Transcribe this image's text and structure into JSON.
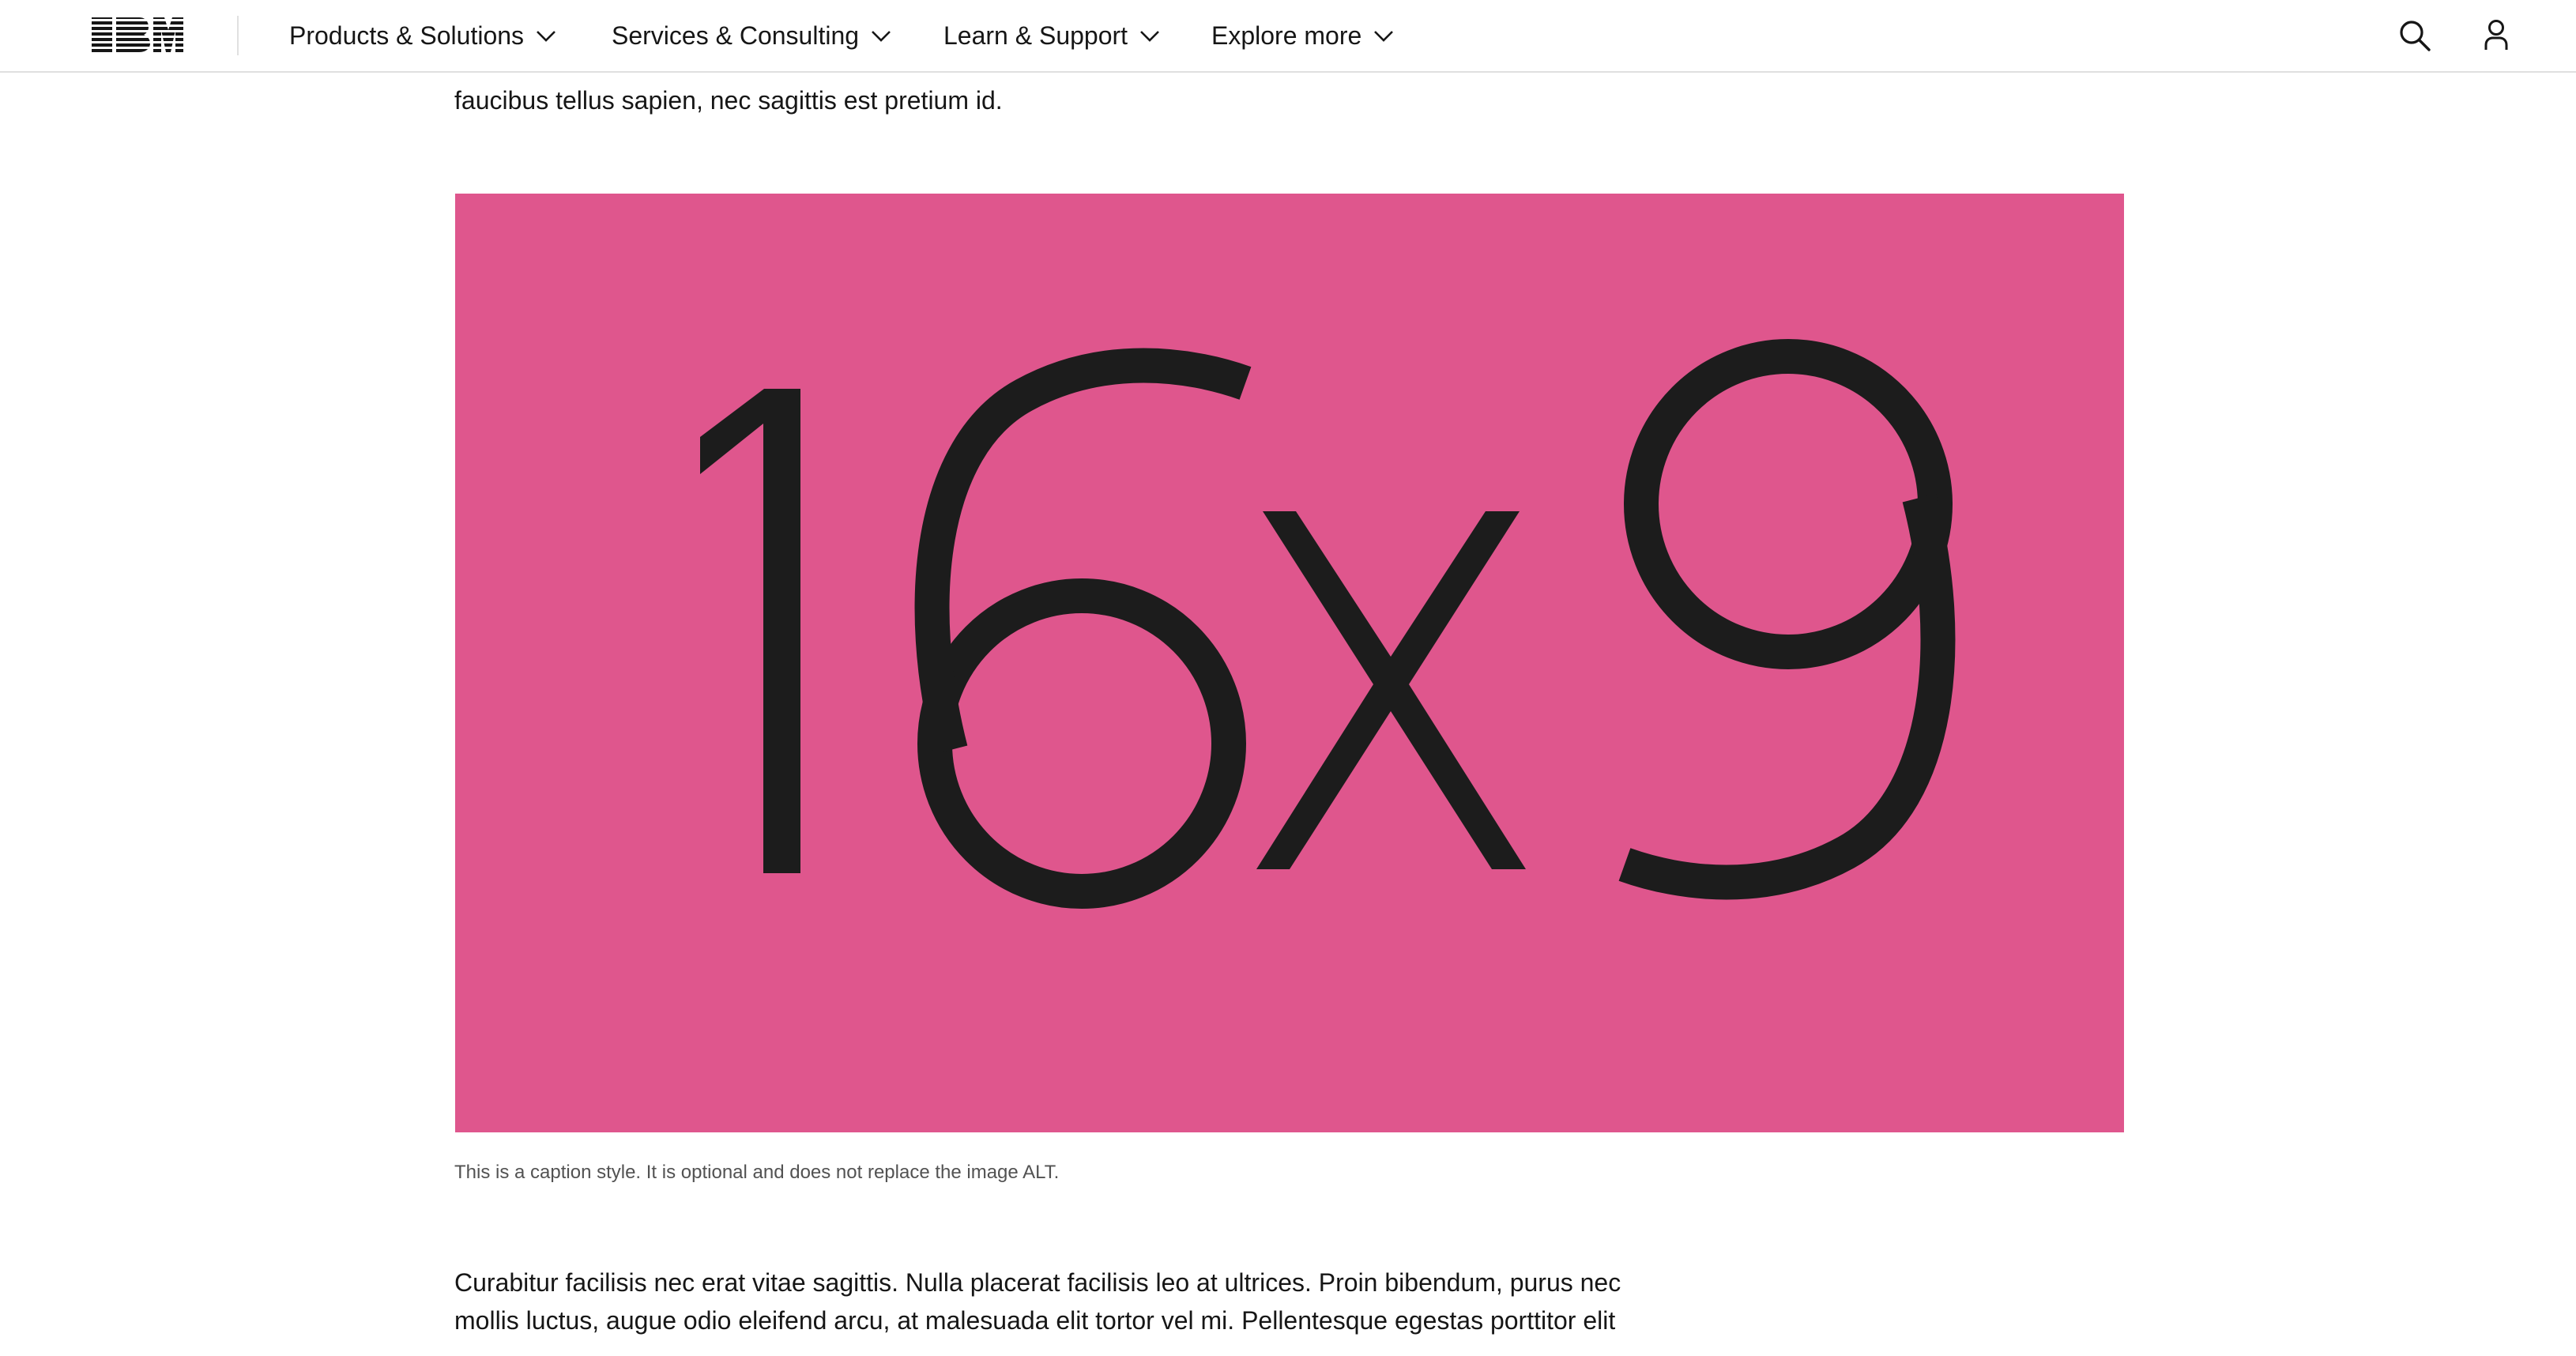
{
  "masthead": {
    "logo_text": "IBM",
    "nav": [
      {
        "label": "Products & Solutions"
      },
      {
        "label": "Services & Consulting"
      },
      {
        "label": "Learn & Support"
      },
      {
        "label": "Explore more"
      }
    ],
    "icons": [
      "search-icon",
      "user-icon"
    ]
  },
  "article": {
    "intro_tail": "faucibus tellus sapien, nec sagittis est pretium id.",
    "image": {
      "label": "16x9",
      "background": "#df568d"
    },
    "caption": "This is a caption style. It is optional and does not replace the image ALT.",
    "paragraph_lines": [
      "Curabitur facilisis nec erat vitae sagittis. Nulla placerat facilisis leo at ultrices. Proin bibendum, purus nec",
      "mollis luctus, augue odio eleifend arcu, at malesuada elit tortor vel mi. Pellentesque egestas porttitor elit"
    ]
  },
  "colors": {
    "accent_pink": "#df568d",
    "text": "#161616",
    "caption": "#525252",
    "border": "#e0e0e0"
  }
}
